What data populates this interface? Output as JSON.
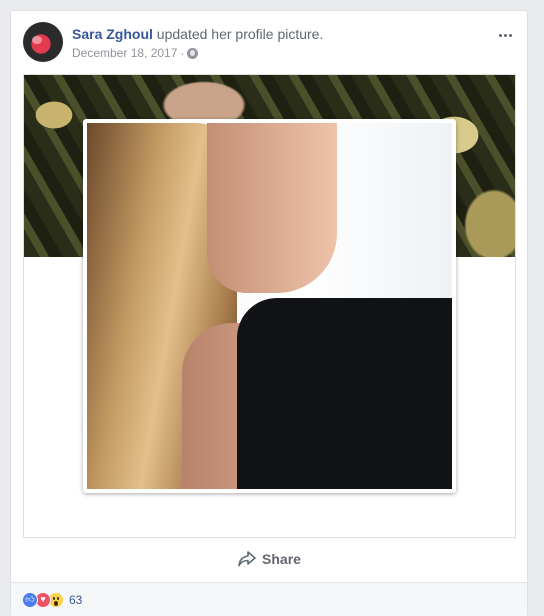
{
  "post": {
    "author": "Sara Zghoul",
    "action": "updated her profile picture.",
    "date": "December 18, 2017",
    "separator": "·",
    "privacy_icon": "globe-icon",
    "menu_icon": "more-options-icon"
  },
  "actions": {
    "share_label": "Share",
    "share_icon": "share-arrow-icon"
  },
  "reactions": {
    "icons": [
      "like-icon",
      "love-icon",
      "wow-icon"
    ],
    "count": "63"
  },
  "colors": {
    "link_blue": "#365899",
    "secondary_text": "#616770",
    "meta_gray": "#90949c",
    "page_background": "#e9ebee",
    "like_blue": "#4a7ded",
    "love_red": "#f25268",
    "wow_yellow": "#fcd14d"
  }
}
